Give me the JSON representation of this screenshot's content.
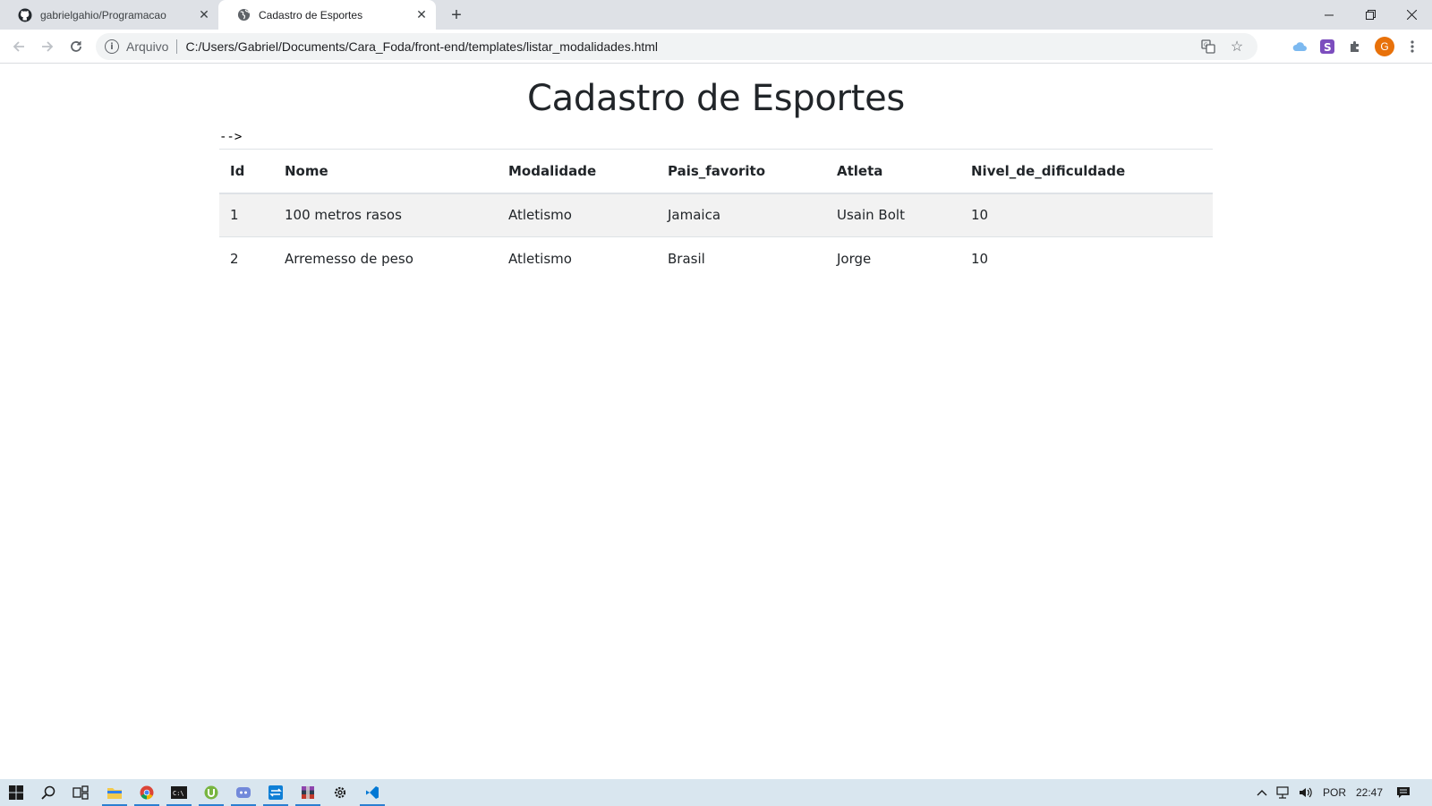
{
  "browser": {
    "tabs": [
      {
        "label": "gabrielgahio/Programacao",
        "icon": "github-icon",
        "active": false
      },
      {
        "label": "Cadastro de Esportes",
        "icon": "globe-icon",
        "active": true
      }
    ],
    "new_tab_icon": "plus-icon",
    "window_controls": [
      "minimize-icon",
      "restore-icon",
      "close-icon"
    ],
    "scheme_label": "Arquivo",
    "url": "C:/Users/Gabriel/Documents/Cara_Foda/front-end/templates/listar_modalidades.html",
    "profile_initial": "G",
    "colors": {
      "tabstrip": "#dee1e6",
      "omnibox": "#f1f3f4",
      "avatar": "#e8710a"
    }
  },
  "page": {
    "title": "Cadastro de Esportes",
    "stray_text": "-->",
    "table": {
      "headers": [
        "Id",
        "Nome",
        "Modalidade",
        "Pais_favorito",
        "Atleta",
        "Nivel_de_dificuldade"
      ],
      "rows": [
        [
          "1",
          "100 metros rasos",
          "Atletismo",
          "Jamaica",
          "Usain Bolt",
          "10"
        ],
        [
          "2",
          "Arremesso de peso",
          "Atletismo",
          "Brasil",
          "Jorge",
          "10"
        ]
      ]
    }
  },
  "taskbar": {
    "items": [
      "windows-start-icon",
      "search-icon",
      "task-view-icon",
      "file-explorer-icon",
      "chrome-icon",
      "terminal-icon",
      "utorrent-icon",
      "discord-icon",
      "app-icon",
      "winrar-icon",
      "settings-icon",
      "vscode-icon"
    ],
    "language": "POR",
    "time": "22:47"
  }
}
